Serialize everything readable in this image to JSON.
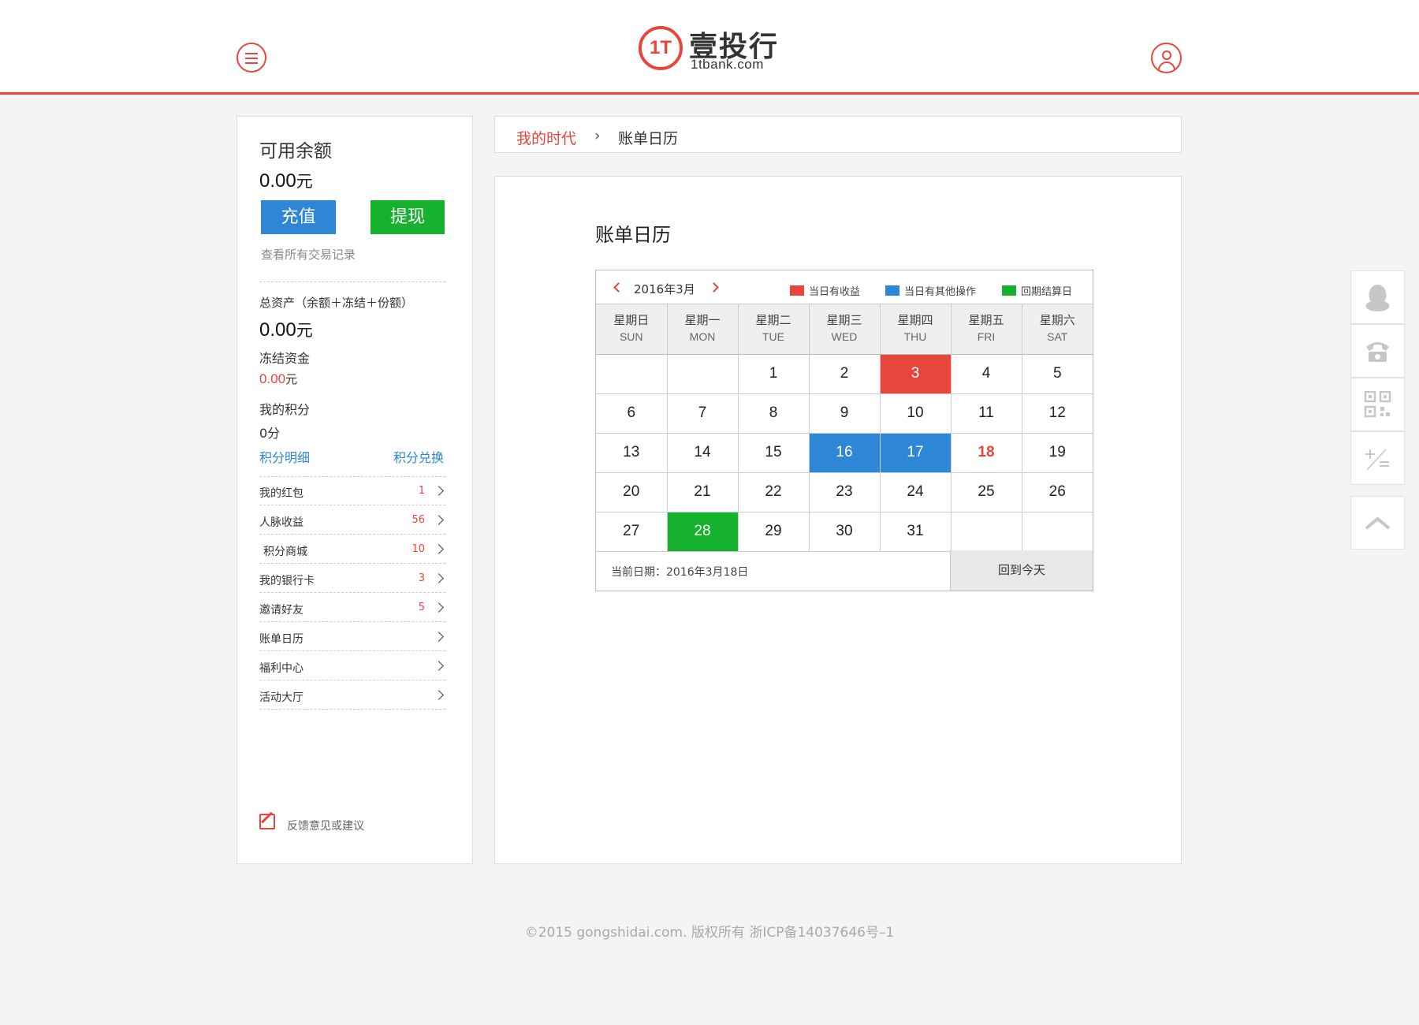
{
  "header": {
    "logo_mark": "1T",
    "logo_name": "壹投行",
    "logo_domain": "1tbank.com"
  },
  "sidebar": {
    "balance_label": "可用余额",
    "balance_amount": "0.00",
    "balance_unit": "元",
    "recharge_label": "充值",
    "withdraw_label": "提现",
    "transactions_link": "查看所有交易记录",
    "total_assets_label": "总资产（余额＋冻结＋份额）",
    "total_assets_amount": "0.00",
    "total_assets_unit": "元",
    "frozen_label": "冻结资金",
    "frozen_amount": "0.00",
    "frozen_unit": "元",
    "points_label": "我的积分",
    "points_value": "0分",
    "points_detail_link": "积分明细",
    "points_exchange_link": "积分兑换",
    "items": [
      {
        "label": "我的红包",
        "count": "1"
      },
      {
        "label": "人脉收益",
        "count": "56"
      },
      {
        "label": "积分商城",
        "count": "10"
      },
      {
        "label": "我的银行卡",
        "count": "3"
      },
      {
        "label": "邀请好友",
        "count": "5"
      },
      {
        "label": "账单日历",
        "count": ""
      },
      {
        "label": "福利中心",
        "count": ""
      },
      {
        "label": "活动大厅",
        "count": ""
      }
    ],
    "feedback_label": "反馈意见或建议"
  },
  "breadcrumb": {
    "home": "我的时代",
    "separator": "›",
    "current": "账单日历"
  },
  "main": {
    "title": "账单日历"
  },
  "calendar": {
    "month_label": "2016年3月",
    "legend": [
      {
        "label": "当日有收益",
        "color": "#e8453c"
      },
      {
        "label": "当日有其他操作",
        "color": "#2d86d6"
      },
      {
        "label": "回期结算日",
        "color": "#16b22e"
      }
    ],
    "weekdays": [
      {
        "cn": "星期日",
        "en": "SUN"
      },
      {
        "cn": "星期一",
        "en": "MON"
      },
      {
        "cn": "星期二",
        "en": "TUE"
      },
      {
        "cn": "星期三",
        "en": "WED"
      },
      {
        "cn": "星期四",
        "en": "THU"
      },
      {
        "cn": "星期五",
        "en": "FRI"
      },
      {
        "cn": "星期六",
        "en": "SAT"
      }
    ],
    "weeks": [
      [
        "",
        "",
        "1",
        "2",
        "3",
        "4",
        "5"
      ],
      [
        "6",
        "7",
        "8",
        "9",
        "10",
        "11",
        "12"
      ],
      [
        "13",
        "14",
        "15",
        "16",
        "17",
        "18",
        "19"
      ],
      [
        "20",
        "21",
        "22",
        "23",
        "24",
        "25",
        "26"
      ],
      [
        "27",
        "28",
        "29",
        "30",
        "31",
        "",
        ""
      ]
    ],
    "marked_days": {
      "3": "red",
      "16": "blue",
      "17": "blue",
      "28": "green"
    },
    "today": "18",
    "current_date_label": "当前日期：2016年3月18日",
    "back_to_today_label": "回到今天"
  },
  "tools": [
    {
      "icon": "qq-penguin-icon"
    },
    {
      "icon": "phone-icon"
    },
    {
      "icon": "qr-code-icon"
    },
    {
      "icon": "calculator-icon"
    },
    {
      "icon": "back-to-top-icon"
    }
  ],
  "footer": {
    "copyright": "©2015 gongshidai.com. 版权所有 浙ICP备14037646号–1"
  },
  "colors": {
    "brand_red": "#e8453c",
    "blue": "#2d86d6",
    "green": "#16b22e"
  }
}
